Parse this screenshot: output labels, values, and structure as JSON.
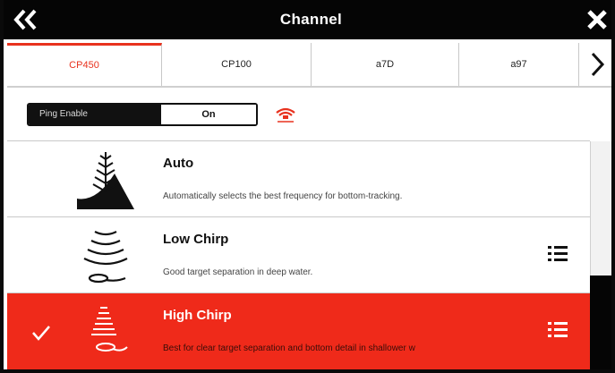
{
  "header": {
    "title": "Channel",
    "back_icon": "double-chevron-left-icon",
    "close_icon": "close-icon"
  },
  "tabs": [
    {
      "label": "CP450",
      "active": true
    },
    {
      "label": "CP100",
      "active": false
    },
    {
      "label": "a7D",
      "active": false
    },
    {
      "label": "a97",
      "active": false
    }
  ],
  "tab_next_icon": "chevron-right-icon",
  "ping": {
    "label": "Ping Enable",
    "value": "On",
    "status_icon": "ping-transducer-icon"
  },
  "channels": [
    {
      "name": "Auto",
      "description": "Automatically selects the best frequency for bottom-tracking.",
      "icon": "auto-sonar-icon",
      "selected": false,
      "has_options": false
    },
    {
      "name": "Low Chirp",
      "description": "Good target separation in deep water.",
      "icon": "low-chirp-icon",
      "selected": false,
      "has_options": true
    },
    {
      "name": "High Chirp",
      "description": "Best for clear target separation and bottom detail in shallower w",
      "icon": "high-chirp-icon",
      "selected": true,
      "has_options": true
    }
  ],
  "colors": {
    "accent": "#ef2a1a",
    "active_tab": "#e8321e",
    "bar": "#050505"
  }
}
